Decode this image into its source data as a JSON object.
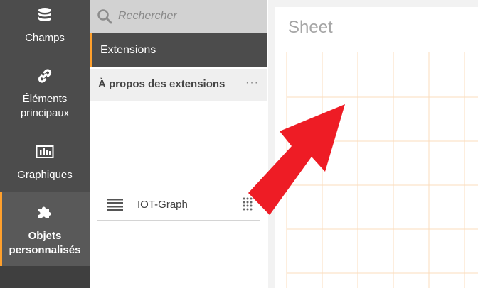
{
  "sidebar": {
    "items": [
      {
        "label": "Champs",
        "icon": "database-icon"
      },
      {
        "label": "Éléments\nprincipaux",
        "icon": "link-icon"
      },
      {
        "label": "Graphiques",
        "icon": "bar-chart-icon"
      },
      {
        "label": "Objets\npersonnalisés",
        "icon": "puzzle-icon",
        "active": true
      }
    ]
  },
  "panel": {
    "search_placeholder": "Rechercher",
    "section_title": "Extensions",
    "about_label": "À propos des extensions",
    "more_label": "···",
    "extensions": [
      {
        "name": "IOT-Graph"
      }
    ]
  },
  "sheet": {
    "title": "Sheet"
  },
  "colors": {
    "nav_bg": "#4c4c4c",
    "accent": "#ffa02c",
    "grid": "#fbdcbc",
    "arrow": "#ee1c25"
  }
}
